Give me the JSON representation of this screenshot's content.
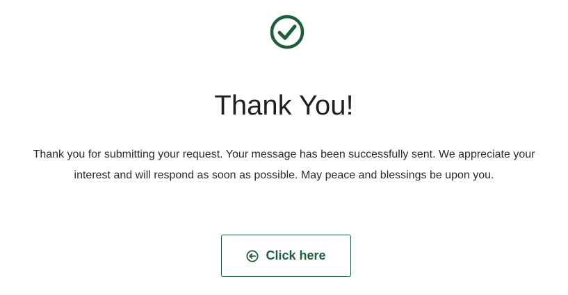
{
  "colors": {
    "accent": "#1e5e3a",
    "text": "#222222",
    "background": "#ffffff"
  },
  "icons": {
    "success": "check-circle-icon",
    "button": "arrow-left-circle-icon"
  },
  "confirmation": {
    "title": "Thank You!",
    "message": "Thank you for submitting your request. Your message has been successfully sent. We appreciate your interest and will respond as soon as possible. May peace and blessings be upon you."
  },
  "action": {
    "button_label": "Click here"
  }
}
